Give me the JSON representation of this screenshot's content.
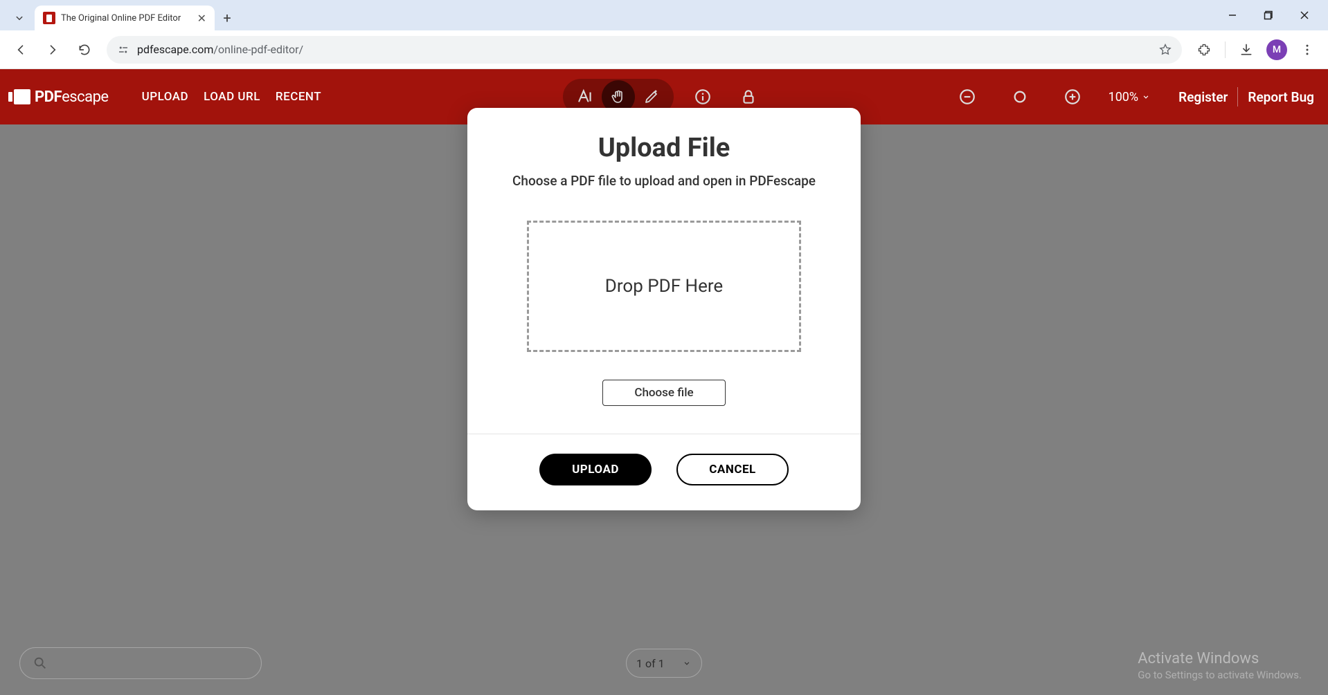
{
  "browser": {
    "tab_title": "The Original Online PDF Editor",
    "url_domain": "pdfescape.com",
    "url_path": "/online-pdf-editor/",
    "avatar_letter": "M"
  },
  "header": {
    "logo_main": "PDF",
    "logo_sub": "escape",
    "links": {
      "upload": "UPLOAD",
      "load_url": "LOAD URL",
      "recent": "RECENT"
    },
    "zoom_label": "100%",
    "register": "Register",
    "report_bug": "Report Bug"
  },
  "footer": {
    "page_indicator": "1 of 1"
  },
  "watermark": {
    "title": "Activate Windows",
    "subtitle": "Go to Settings to activate Windows."
  },
  "modal": {
    "title": "Upload File",
    "subtitle": "Choose a PDF file to upload and open in PDFescape",
    "drop_text": "Drop PDF Here",
    "choose_label": "Choose file",
    "upload_label": "UPLOAD",
    "cancel_label": "CANCEL"
  }
}
